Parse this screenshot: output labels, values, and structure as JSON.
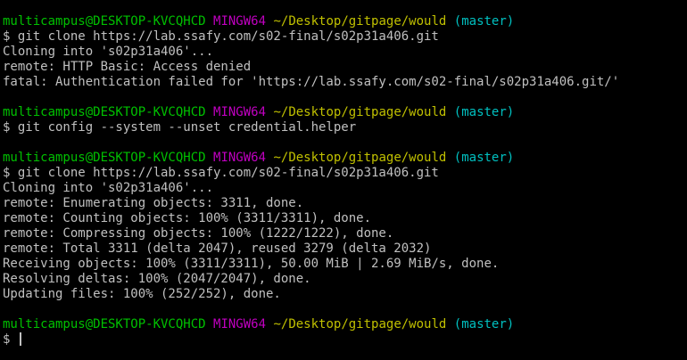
{
  "terminal": {
    "colors": {
      "background": "#000000",
      "text": "#c0c0c0",
      "user": "#00c000",
      "shell": "#c000c0",
      "path": "#c0c000",
      "branch": "#00c0c0"
    },
    "prompts": [
      {
        "user": "multicampus@DESKTOP-KVCQHCD",
        "shell": "MINGW64",
        "path": "~/Desktop/gitpage/would",
        "branch": "(master)"
      },
      {
        "user": "multicampus@DESKTOP-KVCQHCD",
        "shell": "MINGW64",
        "path": "~/Desktop/gitpage/would",
        "branch": "(master)"
      },
      {
        "user": "multicampus@DESKTOP-KVCQHCD",
        "shell": "MINGW64",
        "path": "~/Desktop/gitpage/would",
        "branch": "(master)"
      },
      {
        "user": "multicampus@DESKTOP-KVCQHCD",
        "shell": "MINGW64",
        "path": "~/Desktop/gitpage/would",
        "branch": "(master)"
      }
    ],
    "blocks": [
      {
        "command": "$ git clone https://lab.ssafy.com/s02-final/s02p31a406.git",
        "output": [
          "Cloning into 's02p31a406'...",
          "remote: HTTP Basic: Access denied",
          "fatal: Authentication failed for 'https://lab.ssafy.com/s02-final/s02p31a406.git/'"
        ]
      },
      {
        "command": "$ git config --system --unset credential.helper",
        "output": []
      },
      {
        "command": "$ git clone https://lab.ssafy.com/s02-final/s02p31a406.git",
        "output": [
          "Cloning into 's02p31a406'...",
          "remote: Enumerating objects: 3311, done.",
          "remote: Counting objects: 100% (3311/3311), done.",
          "remote: Compressing objects: 100% (1222/1222), done.",
          "remote: Total 3311 (delta 2047), reused 3279 (delta 2032)",
          "Receiving objects: 100% (3311/3311), 50.00 MiB | 2.69 MiB/s, done.",
          "Resolving deltas: 100% (2047/2047), done.",
          "Updating files: 100% (252/252), done."
        ]
      }
    ],
    "current_input": "$ "
  }
}
